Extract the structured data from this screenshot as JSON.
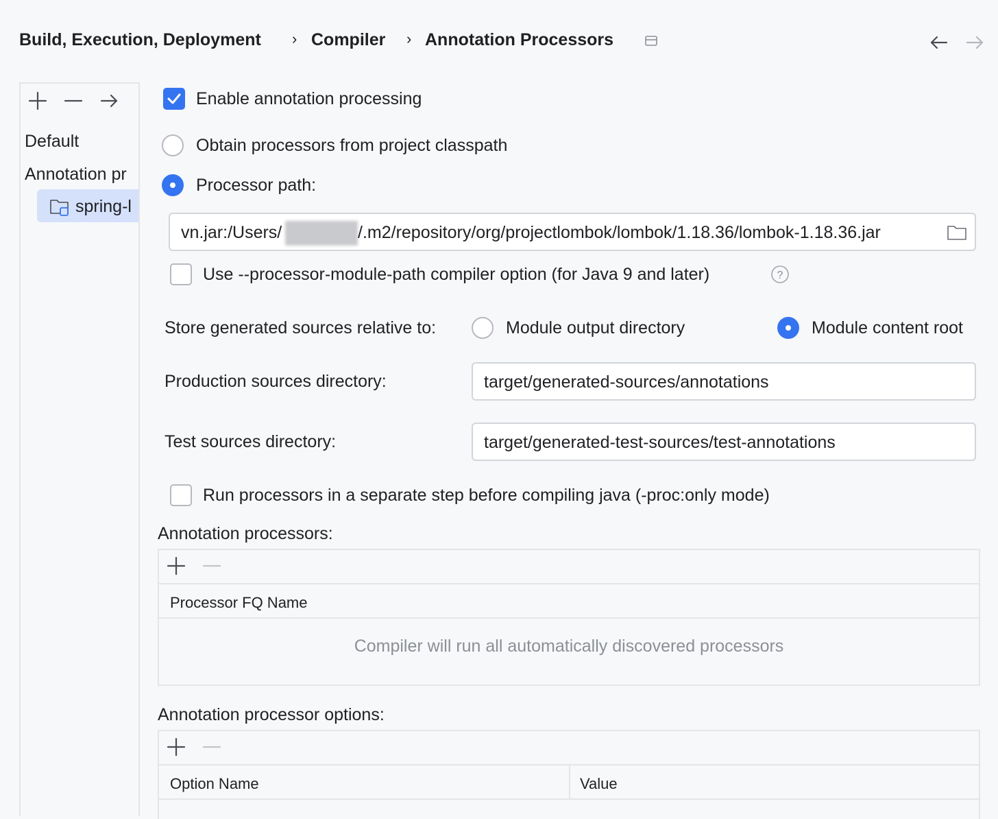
{
  "breadcrumb": {
    "items": [
      "Build, Execution, Deployment",
      "Compiler",
      "Annotation Processors"
    ],
    "separator": "›"
  },
  "sidebar": {
    "toolbar": {
      "add_icon": "plus-icon",
      "remove_icon": "minus-icon",
      "move_icon": "arrow-right-icon"
    },
    "items": [
      {
        "label": "Default"
      },
      {
        "label": "Annotation pr"
      },
      {
        "label": "spring-l",
        "icon": "folder-module-icon",
        "selected": true
      }
    ]
  },
  "settings": {
    "enable_processing": {
      "label": "Enable annotation processing",
      "checked": true
    },
    "obtain_from_classpath": {
      "label": "Obtain processors from project classpath",
      "selected": false
    },
    "processor_path": {
      "label": "Processor path:",
      "selected": true,
      "value_prefix": "vn.jar:/Users/",
      "value_suffix": "/.m2/repository/org/projectlombok/lombok/1.18.36/lombok-1.18.36.jar"
    },
    "module_path_option": {
      "label": "Use --processor-module-path compiler option (for Java 9 and later)",
      "checked": false
    },
    "store_relative": {
      "label": "Store generated sources relative to:",
      "options": [
        {
          "label": "Module output directory",
          "selected": false
        },
        {
          "label": "Module content root",
          "selected": true
        }
      ]
    },
    "production_dir": {
      "label": "Production sources directory:",
      "value": "target/generated-sources/annotations"
    },
    "test_dir": {
      "label": "Test sources directory:",
      "value": "target/generated-test-sources/test-annotations"
    },
    "separate_step": {
      "label": "Run processors in a separate step before compiling java (-proc:only mode)",
      "checked": false
    }
  },
  "annotation_processors": {
    "title": "Annotation processors:",
    "column": "Processor FQ Name",
    "empty_text": "Compiler will run all automatically discovered processors"
  },
  "processor_options": {
    "title": "Annotation processor options:",
    "columns": [
      "Option Name",
      "Value"
    ]
  },
  "colors": {
    "accent": "#3574f0",
    "selection": "#d5e1fb",
    "background": "#f7f8fa"
  }
}
